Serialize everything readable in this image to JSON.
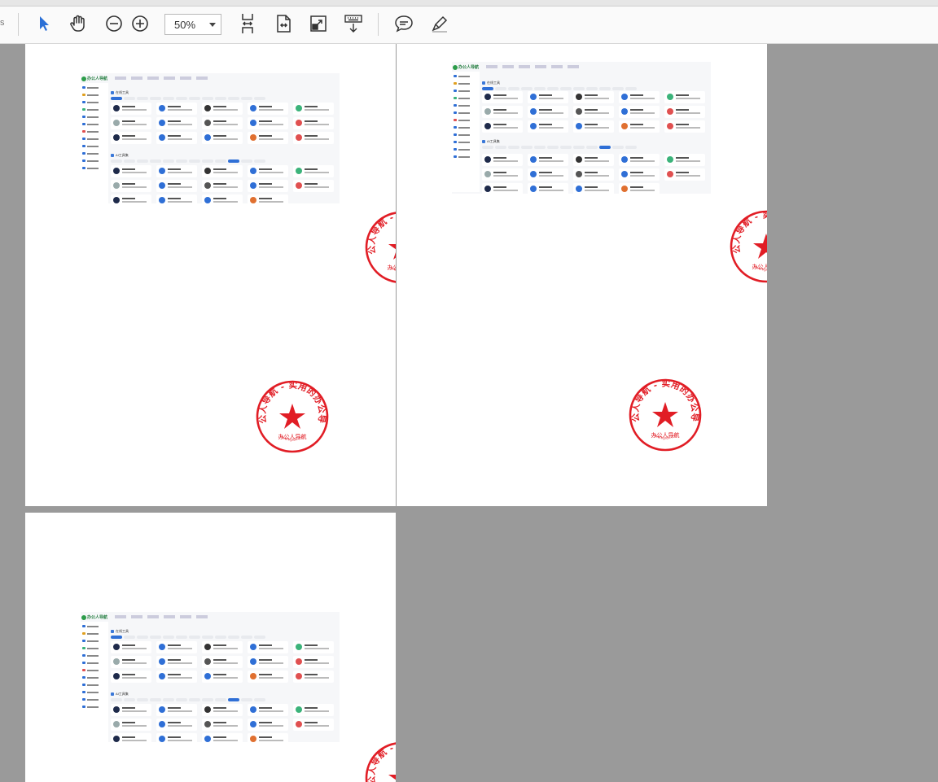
{
  "toolbar": {
    "left_stub": "s",
    "zoom_value": "50%",
    "icons": [
      "select-arrow-icon",
      "hand-tool-icon",
      "zoom-out-icon",
      "zoom-in-icon",
      "fit-page-icon",
      "fit-width-icon",
      "full-screen-icon",
      "keyboard-scroll-icon",
      "comment-icon",
      "highlight-pen-icon"
    ]
  },
  "thumbnail": {
    "logo_text": "办公人导航",
    "sections": [
      "在线工具",
      "AI工具集"
    ],
    "stamp_colors": {
      "red": "#e11d25"
    }
  },
  "stamp": {
    "ring_text": "办公人导航 - 实用的办公导航",
    "center_text": "办公人导航",
    "url_text": "www.bgrdh.com"
  },
  "colors": {
    "viewer_bg": "#9a9a9a",
    "accent_blue": "#2f6fd6",
    "stamp_red": "#e11d25"
  }
}
